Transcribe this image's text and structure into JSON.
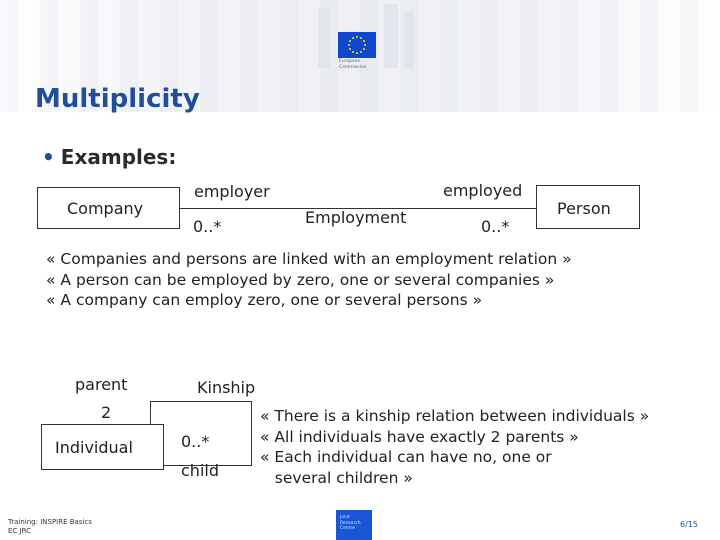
{
  "header": {
    "logo_caption_line1": "European",
    "logo_caption_line2": "Commission"
  },
  "slide": {
    "title": "Multiplicity",
    "bullet": "Examples:"
  },
  "diagram1": {
    "left_class": "Company",
    "right_class": "Person",
    "association_name": "Employment",
    "left_role": "employer",
    "left_multiplicity": "0..*",
    "right_role": "employed",
    "right_multiplicity": "0..*",
    "quotes": [
      "« Companies and persons are linked with an employment relation  »",
      "« A person can be employed by zero, one or several companies »",
      "« A company can employ zero, one or several persons »"
    ]
  },
  "diagram2": {
    "class": "Individual",
    "association_name": "Kinship",
    "parent_role": "parent",
    "parent_multiplicity": "2",
    "child_role": "child",
    "child_multiplicity": "0..*",
    "quotes": [
      "« There is a kinship relation between individuals »",
      "« All individuals have exactly 2 parents »",
      "« Each individual can have no, one or",
      "   several children »"
    ]
  },
  "footer": {
    "left_line1": "Training: INSPIRE Basics",
    "left_line2": "EC JRC",
    "jrc_logo_line1": "Joint",
    "jrc_logo_line2": "Research",
    "jrc_logo_line3": "Centre",
    "page_number": "6/15"
  },
  "colors": {
    "title": "#1f4e9a",
    "ec_blue": "#0e47cb",
    "jrc_blue": "#1a55d6"
  }
}
